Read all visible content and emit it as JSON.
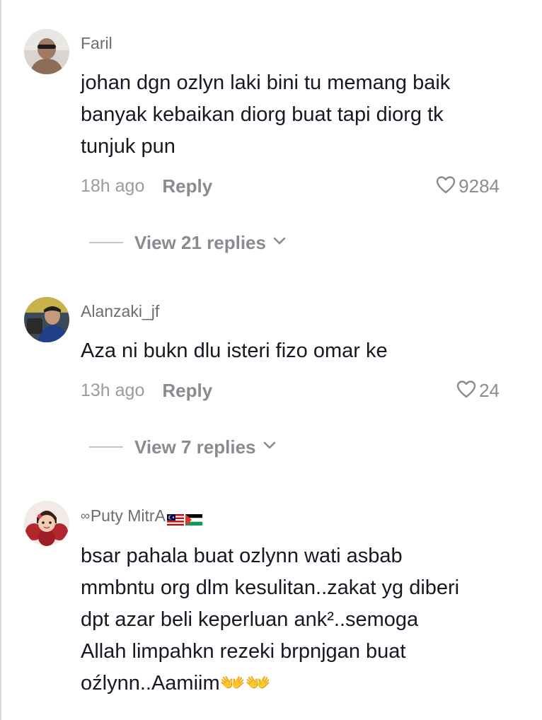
{
  "comments": [
    {
      "username": "Faril",
      "text": "johan dgn ozlyn laki bini tu memang baik\nbanyak kebaikan diorg buat tapi diorg tk\ntunjuk pun",
      "time": "18h ago",
      "reply_label": "Reply",
      "likes": "9284",
      "view_replies": "View 21 replies"
    },
    {
      "username": "Alanzaki_jf",
      "text": "Aza ni bukn dlu isteri fizo omar ke",
      "time": "13h ago",
      "reply_label": "Reply",
      "likes": "24",
      "view_replies": "View 7 replies"
    },
    {
      "username_prefix": "∞",
      "username": "Puty MitrA",
      "text": "bsar pahala buat ozlynn wati asbab\nmmbntu org dlm kesulitan..zakat yg diberi\ndpt azar beli keperluan ank²..semoga\nAllah limpahkn rezeki brpnjgan buat\noźlynn..Aamiim👐👐"
    }
  ],
  "icons": {
    "like": "heart-outline-icon",
    "expand": "chevron-down-icon",
    "flags": [
      "malaysia-flag-icon",
      "palestine-flag-icon"
    ]
  },
  "colors": {
    "text": "#161823",
    "muted": "#8a8b91",
    "username": "#6b6d72"
  }
}
